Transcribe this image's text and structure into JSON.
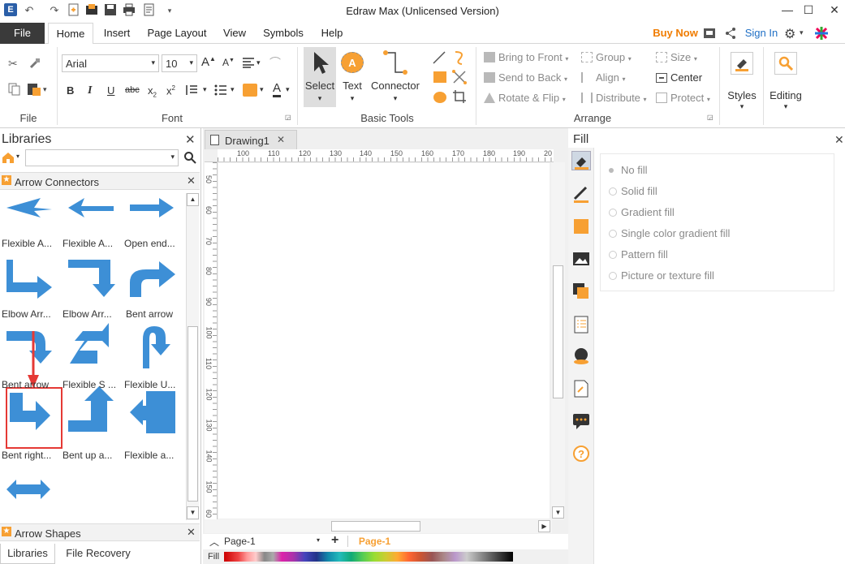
{
  "window": {
    "title": "Edraw Max (Unlicensed Version)",
    "minimize": "—",
    "maximize": "☐",
    "close": "✕"
  },
  "tabs": [
    "File",
    "Home",
    "Insert",
    "Page Layout",
    "View",
    "Symbols",
    "Help"
  ],
  "topright": {
    "buy_now": "Buy Now",
    "sign_in": "Sign In"
  },
  "font": {
    "family": "Arial",
    "size": "10"
  },
  "groups": {
    "file": "File",
    "font": "Font",
    "basic_tools": "Basic Tools",
    "arrange": "Arrange"
  },
  "basic_tools": {
    "select": "Select",
    "text": "Text",
    "connector": "Connector"
  },
  "arrange": {
    "bring_to_front": "Bring to Front",
    "send_to_back": "Send to Back",
    "rotate_flip": "Rotate & Flip",
    "group": "Group",
    "align": "Align",
    "distribute": "Distribute",
    "size": "Size",
    "center": "Center",
    "protect": "Protect"
  },
  "styles_label": "Styles",
  "editing_label": "Editing",
  "libraries": {
    "title": "Libraries",
    "section": "Arrow Connectors",
    "shapes": [
      "Flexible A...",
      "Flexible A...",
      "Open end...",
      "Elbow Arr...",
      "Elbow Arr...",
      "Bent arrow",
      "Bent arrow",
      "Flexible S ...",
      "Flexible U...",
      "Bent right...",
      "Bent up a...",
      "Flexible a..."
    ],
    "bottom_section": "Arrow Shapes",
    "bottom_tabs": [
      "Libraries",
      "File Recovery"
    ]
  },
  "document": {
    "tab": "Drawing1",
    "page_select": "Page-1",
    "page_tab": "Page-1",
    "fill_label": "Fill"
  },
  "ruler": {
    "h": [
      "100",
      "110",
      "120",
      "130",
      "140",
      "150",
      "160",
      "170",
      "180",
      "190",
      "20"
    ],
    "v": [
      "50",
      "60",
      "70",
      "80",
      "90",
      "100",
      "110",
      "120",
      "130",
      "140",
      "150",
      "60"
    ]
  },
  "fill_panel": {
    "title": "Fill",
    "options": [
      "No fill",
      "Solid fill",
      "Gradient fill",
      "Single color gradient fill",
      "Pattern fill",
      "Picture or texture fill"
    ]
  },
  "colors": {
    "accent": "#3d8fd6",
    "orange": "#f7a033",
    "highlight_box": "#e53935",
    "arrow_red": "#e53935"
  }
}
